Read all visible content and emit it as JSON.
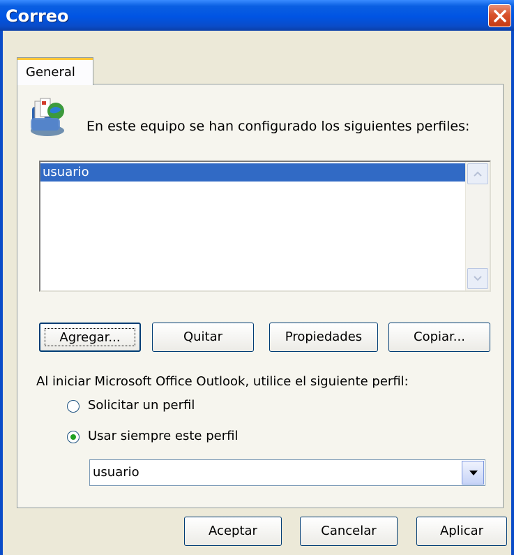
{
  "window": {
    "title": "Correo"
  },
  "tabs": [
    {
      "label": "General",
      "selected": true
    }
  ],
  "intro_text": "En este equipo se han configurado los siguientes perfiles:",
  "profiles": {
    "items": [
      "usuario"
    ],
    "selected_index": 0
  },
  "profile_buttons": {
    "add": "Agregar...",
    "remove": "Quitar",
    "properties": "Propiedades",
    "copy": "Copiar..."
  },
  "startup": {
    "label": "Al iniciar Microsoft Office Outlook, utilice el siguiente perfil:",
    "options": [
      {
        "label": "Solicitar un perfil",
        "selected": false
      },
      {
        "label": "Usar siempre este perfil",
        "selected": true
      }
    ],
    "profile_select": {
      "value": "usuario"
    }
  },
  "dialog_buttons": {
    "ok": "Aceptar",
    "cancel": "Cancelar",
    "apply": "Aplicar"
  },
  "icons": {
    "close": "close-icon",
    "mail": "mail-profiles-icon",
    "scroll_up": "scroll-up-icon",
    "scroll_down": "scroll-down-icon",
    "dropdown": "chevron-down-icon"
  },
  "colors": {
    "titlebar": "#0054E3",
    "selection": "#316AC5",
    "dialog_bg": "#ECE9D8",
    "close_button": "#D9532C"
  }
}
